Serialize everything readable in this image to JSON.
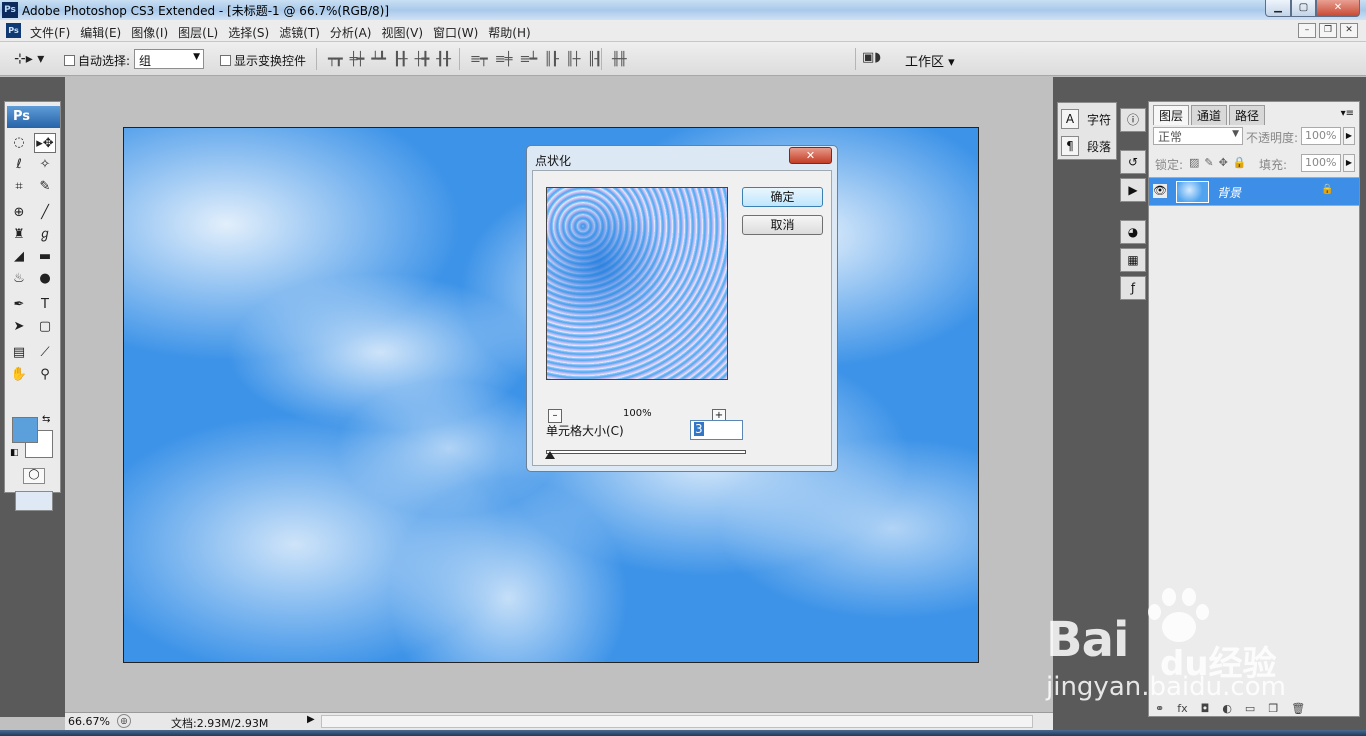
{
  "titlebar": {
    "app_icon": "Ps",
    "title": "Adobe Photoshop CS3 Extended - [未标题-1 @ 66.7%(RGB/8)]",
    "min": "▁",
    "max": "▢",
    "close": "✕"
  },
  "menubar": {
    "items": [
      "文件(F)",
      "编辑(E)",
      "图像(I)",
      "图层(L)",
      "选择(S)",
      "滤镜(T)",
      "分析(A)",
      "视图(V)",
      "窗口(W)",
      "帮助(H)"
    ],
    "doc_min": "–",
    "doc_restore": "❐",
    "doc_close": "✕"
  },
  "options": {
    "tool_icon": "move-tool-icon",
    "auto_select_label": "自动选择:",
    "auto_select_value": "组",
    "show_transform_label": "显示变换控件",
    "workspace_label": "工作区 ▾"
  },
  "toolbox": {
    "logo": "Ps"
  },
  "dialog": {
    "title": "点状化",
    "ok": "确定",
    "cancel": "取消",
    "zoom_value": "100%",
    "zoom_out": "–",
    "zoom_in": "+",
    "cell_size_label": "单元格大小(C)",
    "cell_size_value": "3"
  },
  "statusbar": {
    "zoom": "66.67%",
    "doc_info": "文档:2.93M/2.93M"
  },
  "char_panel": {
    "char_label": "字符",
    "para_label": "段落"
  },
  "layers": {
    "tabs": [
      "图层",
      "通道",
      "路径"
    ],
    "blend_mode": "正常",
    "opacity_label": "不透明度:",
    "opacity_value": "100%",
    "lock_label": "锁定:",
    "fill_label": "填充:",
    "fill_value": "100%",
    "layer_name": "背景"
  },
  "watermark": {
    "brand": "Bai",
    "brand_tail": "du",
    "brand_cn": "经验",
    "url": "jingyan.baidu.com"
  },
  "colors": {
    "foreground": "#5b9fdb",
    "background": "#ffffff",
    "selected_layer": "#3d8ee6"
  }
}
